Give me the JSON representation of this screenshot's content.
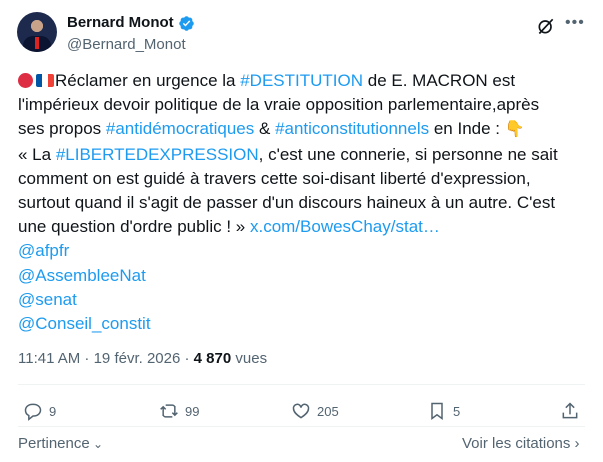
{
  "author": {
    "name": "Bernard Monot",
    "handle": "@Bernard_Monot"
  },
  "tweet": {
    "line1_prefix": "Réclamer en urgence la ",
    "hashtag_destitution": "#DESTITUTION",
    "line1_suffix": " de E. MACRON est",
    "line2": "l'impérieux devoir politique de la vraie opposition parlementaire,après",
    "line3_prefix": "ses propos ",
    "hashtag_antidemo": "#antidémocratiques",
    "amp": " & ",
    "hashtag_anticonst": "#anticonstitutionnels",
    "line3_suffix": " en Inde : ",
    "hand_emoji": "👇",
    "line4_prefix": "« La ",
    "hashtag_liberte": "#LIBERTEDEXPRESSION",
    "line4_suffix": ", c'est une  connerie, si personne ne sait",
    "line5": "comment on est guidé à travers cette soi-disant liberté d'expression,",
    "line6": "surtout quand il s'agit de passer d'un discours haineux à un autre. C'est",
    "line7_prefix": "une question d'ordre public ! » ",
    "link": "x.com/BowesChay/stat…",
    "mentions": [
      "@afpfr",
      "@AssembleeNat",
      "@senat",
      "@Conseil_constit"
    ]
  },
  "meta": {
    "time_date": "11:41 AM · 19 févr. 2026 · ",
    "views_count": "4 870",
    "views_label": " vues"
  },
  "actions": {
    "replies": "9",
    "reposts": "99",
    "likes": "205",
    "bookmarks": "5"
  },
  "footer": {
    "relevance": "Pertinence",
    "quotes": "Voir les citations"
  },
  "colors": {
    "link": "#1d9bf0",
    "text": "#0f1419",
    "muted": "#536471"
  }
}
